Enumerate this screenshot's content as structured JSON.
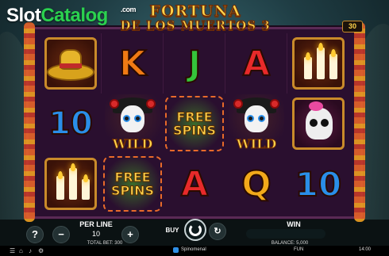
{
  "watermark": {
    "slot": "Slot",
    "catalog": "Catalog",
    "com": ".com"
  },
  "game": {
    "title_line1": "FORTUNA",
    "title_line2": "DE LOS MUERTOS 3",
    "lines_count": "30"
  },
  "reels": [
    [
      {
        "symbol": "sombrero-icon"
      },
      {
        "symbol": "10",
        "text": "10"
      },
      {
        "symbol": "candles-icon"
      }
    ],
    [
      {
        "symbol": "K",
        "text": "K"
      },
      {
        "symbol": "wild",
        "text": "WILD"
      },
      {
        "symbol": "free-spins",
        "text1": "FREE",
        "text2": "SPINS"
      }
    ],
    [
      {
        "symbol": "J",
        "text": "J"
      },
      {
        "symbol": "free-spins",
        "text1": "FREE",
        "text2": "SPINS"
      },
      {
        "symbol": "A",
        "text": "A"
      }
    ],
    [
      {
        "symbol": "A",
        "text": "A"
      },
      {
        "symbol": "wild",
        "text": "WILD"
      },
      {
        "symbol": "Q",
        "text": "Q"
      }
    ],
    [
      {
        "symbol": "candles-icon"
      },
      {
        "symbol": "skull-icon"
      },
      {
        "symbol": "10",
        "text": "10"
      }
    ]
  ],
  "controls": {
    "help": "?",
    "minus": "−",
    "plus": "+",
    "per_line_label": "PER LINE",
    "per_line_value": "10",
    "total_bet": "TOTAL BET: 300",
    "buy": "BUY",
    "win_label": "WIN",
    "balance": "BALANCE: 5,000"
  },
  "statusbar": {
    "brand": "Spinomenal",
    "mode": "FUN",
    "time": "14:00"
  },
  "colors": {
    "accent_gold": "#ffd34a",
    "frame": "#2a0f2f",
    "watermark_green": "#2bd14f"
  }
}
